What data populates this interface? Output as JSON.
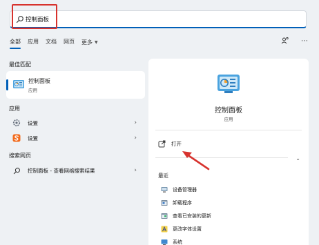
{
  "search": {
    "query": "控制面板"
  },
  "tabs": [
    "全部",
    "应用",
    "文档",
    "网页",
    "更多"
  ],
  "sections": {
    "best_match": "最佳匹配",
    "apps": "应用",
    "web": "搜索网页"
  },
  "best_match": {
    "name": "控制面板",
    "type": "应用"
  },
  "app_results": [
    {
      "label": "设置"
    },
    {
      "label": "设置"
    }
  ],
  "web_result": {
    "text": "控制面板 - 查看网络搜索结果"
  },
  "detail": {
    "name": "控制面板",
    "type": "应用",
    "open_label": "打开",
    "recent_title": "最近",
    "recent_items": [
      "设备管理器",
      "卸载程序",
      "查看已安装的更新",
      "更改字体设置",
      "系统"
    ]
  },
  "colors": {
    "accent": "#005fb8",
    "annotation_red": "#d7322d"
  }
}
